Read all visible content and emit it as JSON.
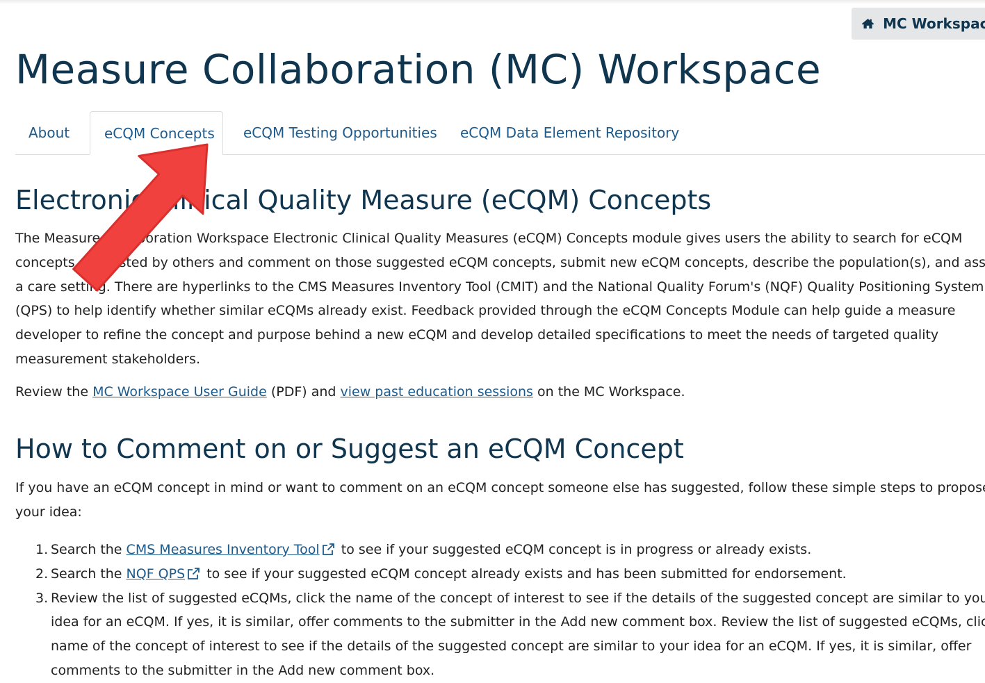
{
  "header": {
    "workspace_button_label": "MC Workspace",
    "page_title": "Measure Collaboration (MC) Workspace"
  },
  "tabs": [
    {
      "label": "About",
      "active": false
    },
    {
      "label": "eCQM Concepts",
      "active": true
    },
    {
      "label": "eCQM Testing Opportunities",
      "active": false
    },
    {
      "label": "eCQM Data Element Repository",
      "active": false
    }
  ],
  "section1": {
    "heading": "Electronic Clinical Quality Measure (eCQM) Concepts",
    "paragraph_lines": [
      "The Measure Collaboration Workspace Electronic Clinical Quality Measures (eCQM) Concepts module gives users the ability to search for eCQM",
      "concepts suggested by others and comment on those suggested eCQM concepts, submit new eCQM concepts, describe the population(s), and assign",
      "a care setting. There are hyperlinks to the CMS Measures Inventory Tool (CMIT) and the National Quality Forum's (NQF) Quality Positioning System",
      "(QPS) to help identify whether similar eCQMs already exist. Feedback provided through the eCQM Concepts Module can help guide a measure",
      "developer to refine the concept and purpose behind a new eCQM and develop detailed specifications to meet the needs of targeted quality",
      "measurement stakeholders."
    ],
    "review": {
      "prefix": "Review the ",
      "link1": "MC Workspace User Guide",
      "middle": " (PDF) and ",
      "link2": "view past education sessions",
      "suffix": " on the MC Workspace."
    }
  },
  "section2": {
    "heading": "How to Comment on or Suggest an eCQM Concept",
    "intro_lines": [
      "If you have an eCQM concept in mind or want to comment on an eCQM concept someone else has suggested, follow these simple steps to propose",
      "your idea:"
    ],
    "steps": [
      {
        "num": "1.",
        "prefix": "Search the ",
        "link": "CMS Measures Inventory Tool",
        "suffix": " to see if your suggested eCQM concept is in progress or already exists."
      },
      {
        "num": "2.",
        "prefix": "Search the ",
        "link": "NQF QPS",
        "suffix": " to see if your suggested eCQM concept already exists and has been submitted for endorsement."
      },
      {
        "num": "3.",
        "lines": [
          "Review the list of suggested eCQMs, click the name of the concept of interest to see if the details of the suggested concept are similar to your",
          "idea for an eCQM. If yes, it is similar, offer comments to the submitter in the Add new comment box. Review the list of suggested eCQMs, click the",
          "name of the concept of interest to see if the details of the suggested concept are similar to your idea for an eCQM. If yes, it is similar, offer",
          "comments to the submitter in the Add new comment box."
        ]
      }
    ]
  },
  "colors": {
    "heading": "#10354f",
    "link": "#1d5a8c",
    "arrow": "#f0413e"
  },
  "icons": {
    "workspace_button": "home-icon",
    "external_link": "external-link-icon",
    "annotation": "red-arrow-pointer"
  }
}
